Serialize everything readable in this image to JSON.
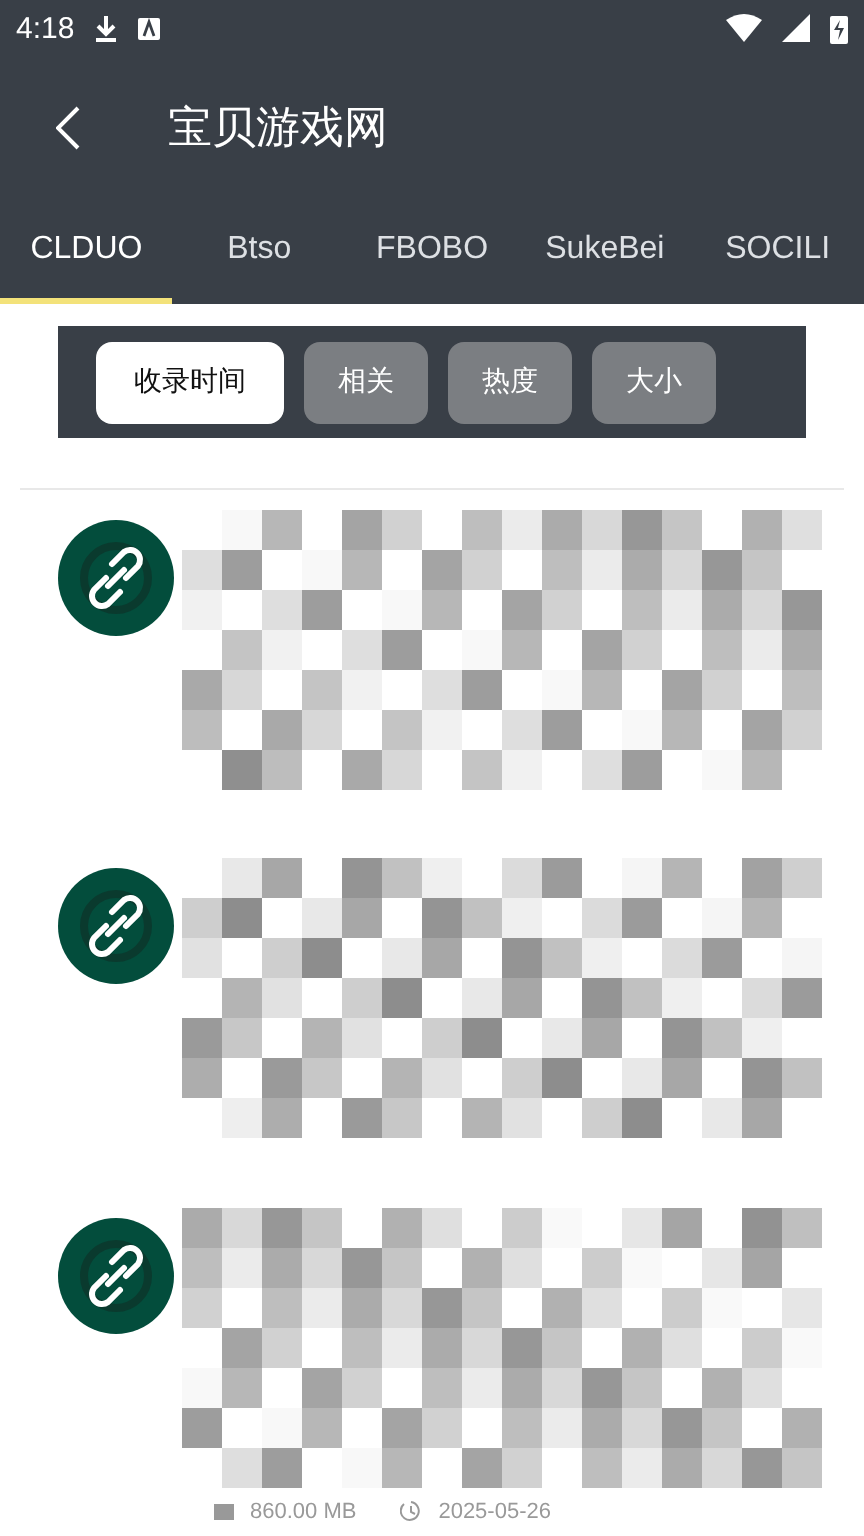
{
  "status_bar": {
    "time": "4:18"
  },
  "app_bar": {
    "title": "宝贝游戏网"
  },
  "tabs": [
    {
      "label": "CLDUO",
      "selected": true
    },
    {
      "label": "Btso",
      "selected": false
    },
    {
      "label": "FBOBO",
      "selected": false
    },
    {
      "label": "SukeBei",
      "selected": false
    },
    {
      "label": "SOCILI",
      "selected": false
    }
  ],
  "sort_chips": [
    {
      "label": "收录时间",
      "selected": true
    },
    {
      "label": "相关",
      "selected": false
    },
    {
      "label": "热度",
      "selected": false
    },
    {
      "label": "大小",
      "selected": false
    }
  ],
  "results": [
    {
      "kind": "link"
    },
    {
      "kind": "link"
    },
    {
      "kind": "link",
      "size": "860.00 MB",
      "date": "2025-05-26"
    }
  ]
}
